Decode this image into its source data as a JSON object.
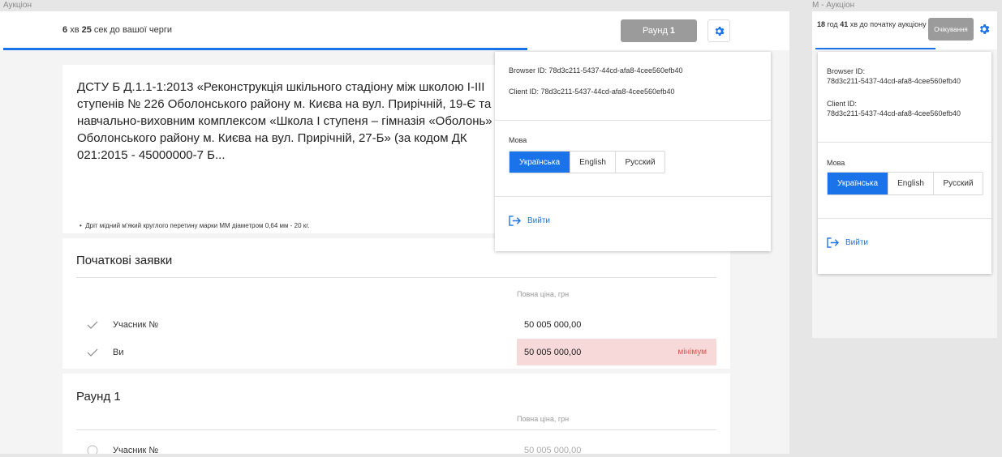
{
  "frames": {
    "desktop_label": "Аукціон",
    "mobile_label": "M - Аукціон"
  },
  "desktop": {
    "timer": {
      "minutes": "6",
      "min_unit": "хв",
      "seconds": "25",
      "sec_unit": "сек до вашої черги"
    },
    "round_button": {
      "label": "Раунд",
      "number": "1"
    },
    "lot": {
      "title": "ДСТУ Б Д.1.1-1:2013 «Реконструкція шкільного стадіону між школою І-ІІІ ступенів № 226 Оболонського району м. Києва на вул. Прирічній, 19-Є та навчально-виховним комплексом «Школа І ступеня – гімназія «Оболонь» Оболонського району м. Києва на вул. Прирічній, 27-Б» (за кодом ДК 021:2015 - 45000000-7 Б...",
      "item": "Дріт мідний м'який круглого перетину марки ММ діаметром 0,64 мм - 20 кг."
    },
    "initial_bids": {
      "title": "Початкові заявки",
      "column_header": "Повна ціна, грн",
      "rows": [
        {
          "name": "Учасник №",
          "price": "50 005 000,00"
        },
        {
          "name": "Ви",
          "price": "50 005 000,00",
          "badge": "мінімум"
        }
      ]
    },
    "round1": {
      "title": "Раунд 1",
      "column_header": "Повна ціна, грн",
      "rows": [
        {
          "name": "Учасник №",
          "price": "50 005 000,00"
        }
      ]
    }
  },
  "settings": {
    "browser_id_label": "Browser ID:",
    "browser_id": "78d3c211-5437-44cd-afa8-4cee560efb40",
    "client_id_label": "Client ID:",
    "client_id": "78d3c211-5437-44cd-afa8-4cee560efb40",
    "language_label": "Мова",
    "languages": [
      "Українська",
      "English",
      "Русский"
    ],
    "active_language": "Українська",
    "logout_label": "Вийти"
  },
  "mobile": {
    "timer": {
      "hours": "18",
      "hour_unit": "год",
      "minutes": "41",
      "min_unit": "хв до початку аукціону"
    },
    "status_button": "Очікування"
  },
  "colors": {
    "accent": "#1a73e8",
    "disabled": "#9b9b9b",
    "min_bg": "#f7d9d9",
    "min_text": "#e05252"
  }
}
